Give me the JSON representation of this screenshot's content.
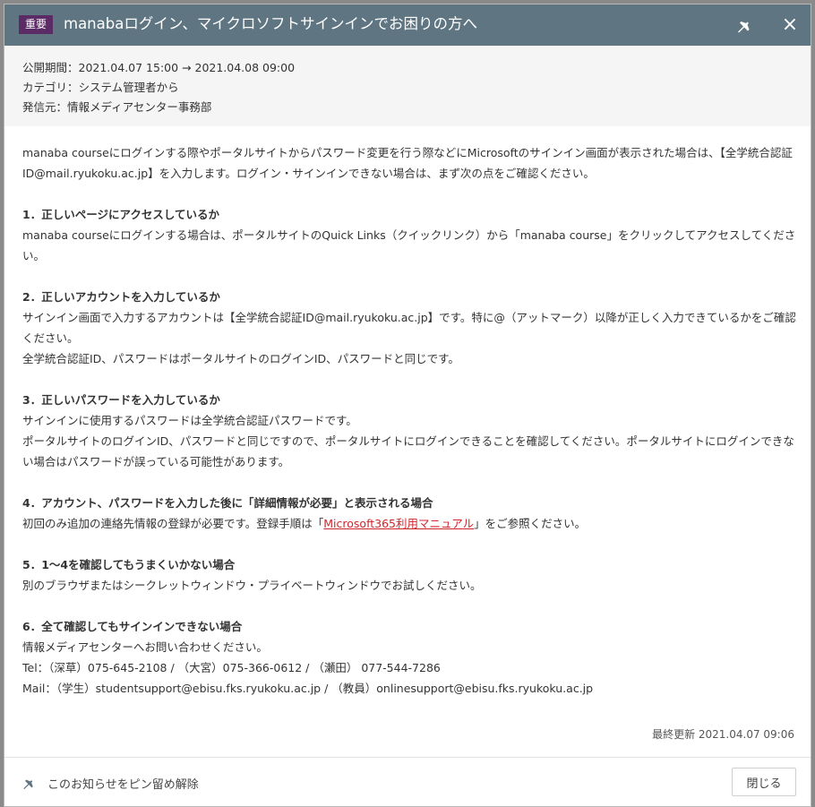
{
  "header": {
    "badge": "重要",
    "title": "manabaログイン、マイクロソフトサインインでお困りの方へ"
  },
  "meta": {
    "period": "公開期間：2021.04.07 15:00 → 2021.04.08 09:00",
    "category": "カテゴリ：システム管理者から",
    "sender": "発信元：情報メディアセンター事務部"
  },
  "body": {
    "intro": "manaba courseにログインする際やポータルサイトからパスワード変更を行う際などにMicrosoftのサインイン画面が表示された場合は、【全学統合認証ID@mail.ryukoku.ac.jp】を入力します。ログイン・サインインできない場合は、まず次の点をご確認ください。",
    "s1_title": "1．正しいページにアクセスしているか",
    "s1_p1": "manaba courseにログインする場合は、ポータルサイトのQuick Links（クイックリンク）から「manaba course」をクリックしてアクセスしてください。",
    "s2_title": "2．正しいアカウントを入力しているか",
    "s2_p1": "サインイン画面で入力するアカウントは【全学統合認証ID@mail.ryukoku.ac.jp】です。特に@（アットマーク）以降が正しく入力できているかをご確認ください。",
    "s2_p2": "全学統合認証ID、パスワードはポータルサイトのログインID、パスワードと同じです。",
    "s3_title": "3．正しいパスワードを入力しているか",
    "s3_p1": "サインインに使用するパスワードは全学統合認証パスワードです。",
    "s3_p2": "ポータルサイトのログインID、パスワードと同じですので、ポータルサイトにログインできることを確認してください。ポータルサイトにログインできない場合はパスワードが誤っている可能性があります。",
    "s4_title": "4．アカウント、パスワードを入力した後に「詳細情報が必要」と表示される場合",
    "s4_pre": "初回のみ追加の連絡先情報の登録が必要です。登録手順は「",
    "s4_link": "Microsoft365利用マニュアル",
    "s4_post": "」をご参照ください。",
    "s5_title": "5．1～4を確認してもうまくいかない場合",
    "s5_p1": "別のブラウザまたはシークレットウィンドウ・プライベートウィンドウでお試しください。",
    "s6_title": "6．全て確認してもサインインできない場合",
    "s6_p1": "情報メディアセンターへお問い合わせください。",
    "s6_tel": "Tel：（深草）075-645-2108 / （大宮）075-366-0612 / （瀬田） 077-544-7286",
    "s6_mail": "Mail：（学生）studentsupport@ebisu.fks.ryukoku.ac.jp / （教員）onlinesupport@ebisu.fks.ryukoku.ac.jp"
  },
  "updated": "最終更新 2021.04.07 09:06",
  "footer": {
    "unpin_label": "このお知らせをピン留め解除",
    "close_label": "閉じる"
  },
  "icons": {
    "pin": "pin-icon",
    "close": "close-icon"
  },
  "colors": {
    "header_bg": "#5f7582",
    "badge_bg": "#5b2b66",
    "link": "#d0262b"
  }
}
